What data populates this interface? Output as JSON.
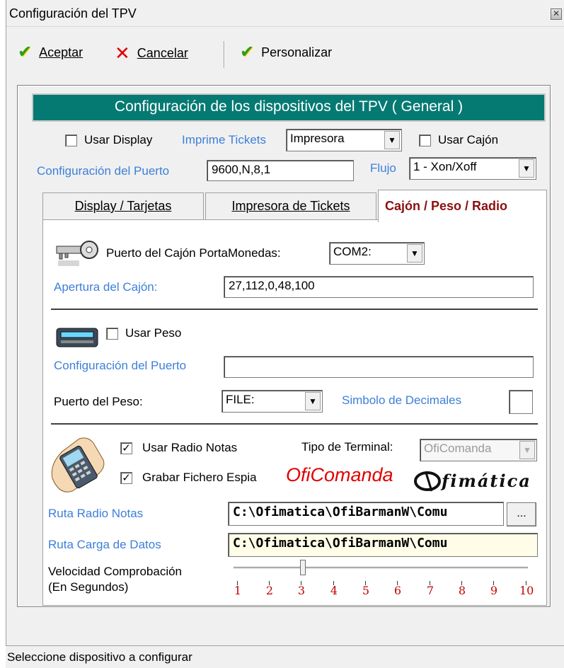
{
  "window": {
    "title": "Configuración del TPV",
    "close_glyph": "✕"
  },
  "toolbar": {
    "accept_label": "Aceptar",
    "cancel_label": "Cancelar",
    "customize_label": "Personalizar"
  },
  "header": {
    "title": "Configuración de los dispositivos del TPV ( General )"
  },
  "general": {
    "use_display_label": "Usar Display",
    "use_display_checked": false,
    "print_tickets_label": "Imprime Tickets",
    "print_tickets_value": "Impresora",
    "use_drawer_label": "Usar Cajón",
    "use_drawer_checked": false,
    "port_config_label": "Configuración del Puerto",
    "port_config_value": "9600,N,8,1",
    "flow_label": "Flujo",
    "flow_value": "1 - Xon/Xoff"
  },
  "tabs": [
    {
      "label": "Display / Tarjetas",
      "active": false
    },
    {
      "label": "Impresora de Tickets",
      "active": false
    },
    {
      "label": "Cajón / Peso / Radio",
      "active": true
    }
  ],
  "drawer": {
    "port_label": "Puerto del Cajón PortaMonedas:",
    "port_value": "COM2:",
    "opening_label": "Apertura del Cajón:",
    "opening_value": "27,112,0,48,100"
  },
  "scale": {
    "use_scale_label": "Usar Peso",
    "use_scale_checked": false,
    "port_config_label": "Configuración del Puerto",
    "port_config_value": "",
    "port_label": "Puerto del Peso:",
    "port_value": "FILE:",
    "decimal_symbol_label": "Simbolo de Decimales",
    "decimal_symbol_value": ""
  },
  "radio": {
    "use_radio_label": "Usar Radio Notas",
    "use_radio_checked": true,
    "terminal_type_label": "Tipo de Terminal:",
    "terminal_type_value": "OfiComanda",
    "spy_file_label": "Grabar Fichero Espia",
    "spy_file_checked": true,
    "brand_logo_text": "OfiComanda",
    "company_logo_text": "fimática",
    "path_label": "Ruta Radio Notas",
    "path_value": "C:\\Ofimatica\\OfiBarmanW\\Comu",
    "browse_label": "...",
    "load_path_label": "Ruta Carga de Datos",
    "load_path_value": "C:\\Ofimatica\\OfiBarmanW\\Comu",
    "speed_label_1": "Velocidad Comprobación",
    "speed_label_2": "(En Segundos)",
    "speed_value": 3,
    "speed_ticks": [
      "1",
      "2",
      "3",
      "4",
      "5",
      "6",
      "7",
      "8",
      "9",
      "10"
    ]
  },
  "status": {
    "text": "Seleccione dispositivo a configurar"
  },
  "colors": {
    "header_bg": "#057a73",
    "active_tab_text": "#8b1010",
    "label_blue": "#3d7fd9",
    "load_path_bg": "#fffde8"
  }
}
